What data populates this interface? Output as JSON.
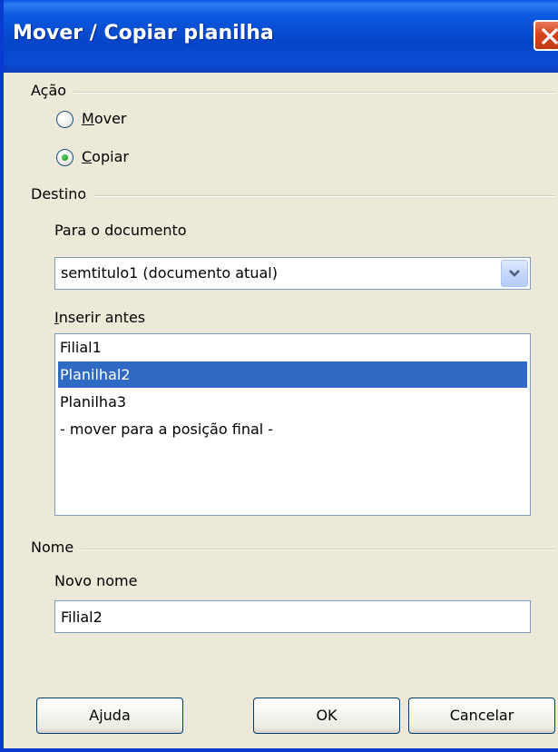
{
  "window": {
    "title": "Mover / Copiar planilha",
    "close_icon": "close-icon"
  },
  "action_group": {
    "label": "Ação",
    "options": [
      {
        "label": "Mover",
        "selected": false
      },
      {
        "label": "Copiar",
        "selected": true
      }
    ]
  },
  "destination_group": {
    "label": "Destino",
    "document_label": "Para o documento",
    "document_value": "semtitulo1 (documento atual)",
    "insert_before_label": "Inserir antes",
    "sheets": [
      {
        "label": "Filial1",
        "selected": false
      },
      {
        "label": "Planilhal2",
        "selected": true
      },
      {
        "label": "Planilha3",
        "selected": false
      },
      {
        "label": "- mover para a posição final -",
        "selected": false
      }
    ]
  },
  "name_group": {
    "label": "Nome",
    "new_name_label": "Novo nome",
    "new_name_value": "Filial2"
  },
  "buttons": {
    "help": "Ajuda",
    "ok": "OK",
    "cancel": "Cancelar"
  },
  "colors": {
    "titlebar": "#0a4ad3",
    "selection": "#316ac5",
    "dialog_bg": "#ece9d8",
    "close_button": "#d5451f"
  }
}
